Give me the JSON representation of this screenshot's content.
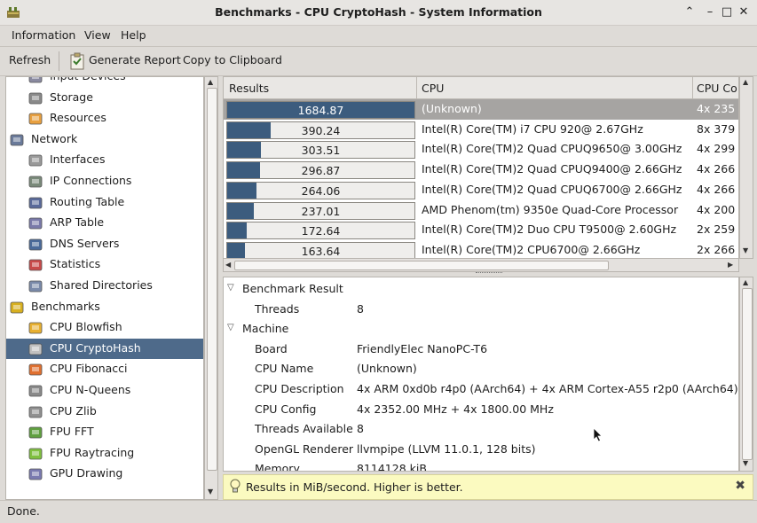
{
  "window": {
    "title": "Benchmarks - CPU CryptoHash - System Information",
    "controls": [
      "⌃",
      "–",
      "□",
      "✕"
    ]
  },
  "menu": {
    "items": [
      {
        "label": "Information"
      },
      {
        "label": "View"
      },
      {
        "label": "Help"
      }
    ]
  },
  "toolbar": {
    "refresh": "Refresh",
    "generate_report": "Generate Report",
    "copy": "Copy to Clipboard"
  },
  "sidebar": {
    "items": [
      {
        "label": "Input Devices",
        "icon": "input-devices-icon",
        "indent": 2
      },
      {
        "label": "Storage",
        "icon": "storage-icon",
        "indent": 2
      },
      {
        "label": "Resources",
        "icon": "resources-icon",
        "indent": 2
      },
      {
        "label": "Network",
        "icon": "network-icon",
        "indent": 1
      },
      {
        "label": "Interfaces",
        "icon": "interfaces-icon",
        "indent": 2
      },
      {
        "label": "IP Connections",
        "icon": "ip-connections-icon",
        "indent": 2
      },
      {
        "label": "Routing Table",
        "icon": "routing-table-icon",
        "indent": 2
      },
      {
        "label": "ARP Table",
        "icon": "arp-table-icon",
        "indent": 2
      },
      {
        "label": "DNS Servers",
        "icon": "dns-servers-icon",
        "indent": 2
      },
      {
        "label": "Statistics",
        "icon": "statistics-icon",
        "indent": 2
      },
      {
        "label": "Shared Directories",
        "icon": "shared-directories-icon",
        "indent": 2
      },
      {
        "label": "Benchmarks",
        "icon": "benchmarks-icon",
        "indent": 1
      },
      {
        "label": "CPU Blowfish",
        "icon": "cpu-blowfish-icon",
        "indent": 2
      },
      {
        "label": "CPU CryptoHash",
        "icon": "cpu-cryptohash-icon",
        "indent": 2,
        "selected": true
      },
      {
        "label": "CPU Fibonacci",
        "icon": "cpu-fibonacci-icon",
        "indent": 2
      },
      {
        "label": "CPU N-Queens",
        "icon": "cpu-nqueens-icon",
        "indent": 2
      },
      {
        "label": "CPU Zlib",
        "icon": "cpu-zlib-icon",
        "indent": 2
      },
      {
        "label": "FPU FFT",
        "icon": "fpu-fft-icon",
        "indent": 2
      },
      {
        "label": "FPU Raytracing",
        "icon": "fpu-raytracing-icon",
        "indent": 2
      },
      {
        "label": "GPU Drawing",
        "icon": "gpu-drawing-icon",
        "indent": 2
      }
    ]
  },
  "results": {
    "columns": [
      "Results",
      "CPU",
      "CPU Co"
    ],
    "max_value": 1684.87,
    "rows": [
      {
        "value": "1684.87",
        "num": 1684.87,
        "cpu": "(Unknown)",
        "cores": "4x 235",
        "selected": true
      },
      {
        "value": "390.24",
        "num": 390.24,
        "cpu": "Intel(R) Core(TM) i7 CPU 920@ 2.67GHz",
        "cores": "8x 379"
      },
      {
        "value": "303.51",
        "num": 303.51,
        "cpu": "Intel(R) Core(TM)2 Quad CPUQ9650@ 3.00GHz",
        "cores": "4x 299"
      },
      {
        "value": "296.87",
        "num": 296.87,
        "cpu": "Intel(R) Core(TM)2 Quad CPUQ9400@ 2.66GHz",
        "cores": "4x 266"
      },
      {
        "value": "264.06",
        "num": 264.06,
        "cpu": "Intel(R) Core(TM)2 Quad CPUQ6700@ 2.66GHz",
        "cores": "4x 266"
      },
      {
        "value": "237.01",
        "num": 237.01,
        "cpu": "AMD Phenom(tm) 9350e Quad-Core Processor",
        "cores": "4x 200"
      },
      {
        "value": "172.64",
        "num": 172.64,
        "cpu": "Intel(R) Core(TM)2 Duo CPU T9500@ 2.60GHz",
        "cores": "2x 259"
      },
      {
        "value": "163.64",
        "num": 163.64,
        "cpu": "Intel(R) Core(TM)2 CPU6700@ 2.66GHz",
        "cores": "2x 266"
      }
    ]
  },
  "details": {
    "lines": [
      {
        "type": "section",
        "key": "Benchmark Result"
      },
      {
        "type": "kv",
        "key": "Threads",
        "value": "8"
      },
      {
        "type": "section",
        "key": "Machine"
      },
      {
        "type": "kv",
        "key": "Board",
        "value": "FriendlyElec NanoPC-T6"
      },
      {
        "type": "kv",
        "key": "CPU Name",
        "value": "(Unknown)"
      },
      {
        "type": "kv",
        "key": "CPU Description",
        "value": "4x ARM 0xd0b r4p0 (AArch64) + 4x ARM Cortex-A55 r2p0 (AArch64)"
      },
      {
        "type": "kv",
        "key": "CPU Config",
        "value": "4x 2352.00 MHz + 4x 1800.00 MHz"
      },
      {
        "type": "kv",
        "key": "Threads Available",
        "value": "8"
      },
      {
        "type": "kv",
        "key": "OpenGL Renderer",
        "value": "llvmpipe (LLVM 11.0.1, 128 bits)"
      },
      {
        "type": "kv",
        "key": "Memory",
        "value": "8114128 kiB"
      }
    ]
  },
  "infobar": {
    "text": "Results in MiB/second. Higher is better."
  },
  "status": {
    "text": "Done."
  },
  "colors": {
    "selection": "#4e6a8a",
    "bar_fill": "#3c5c7e",
    "info_bg": "#fbfac0"
  }
}
